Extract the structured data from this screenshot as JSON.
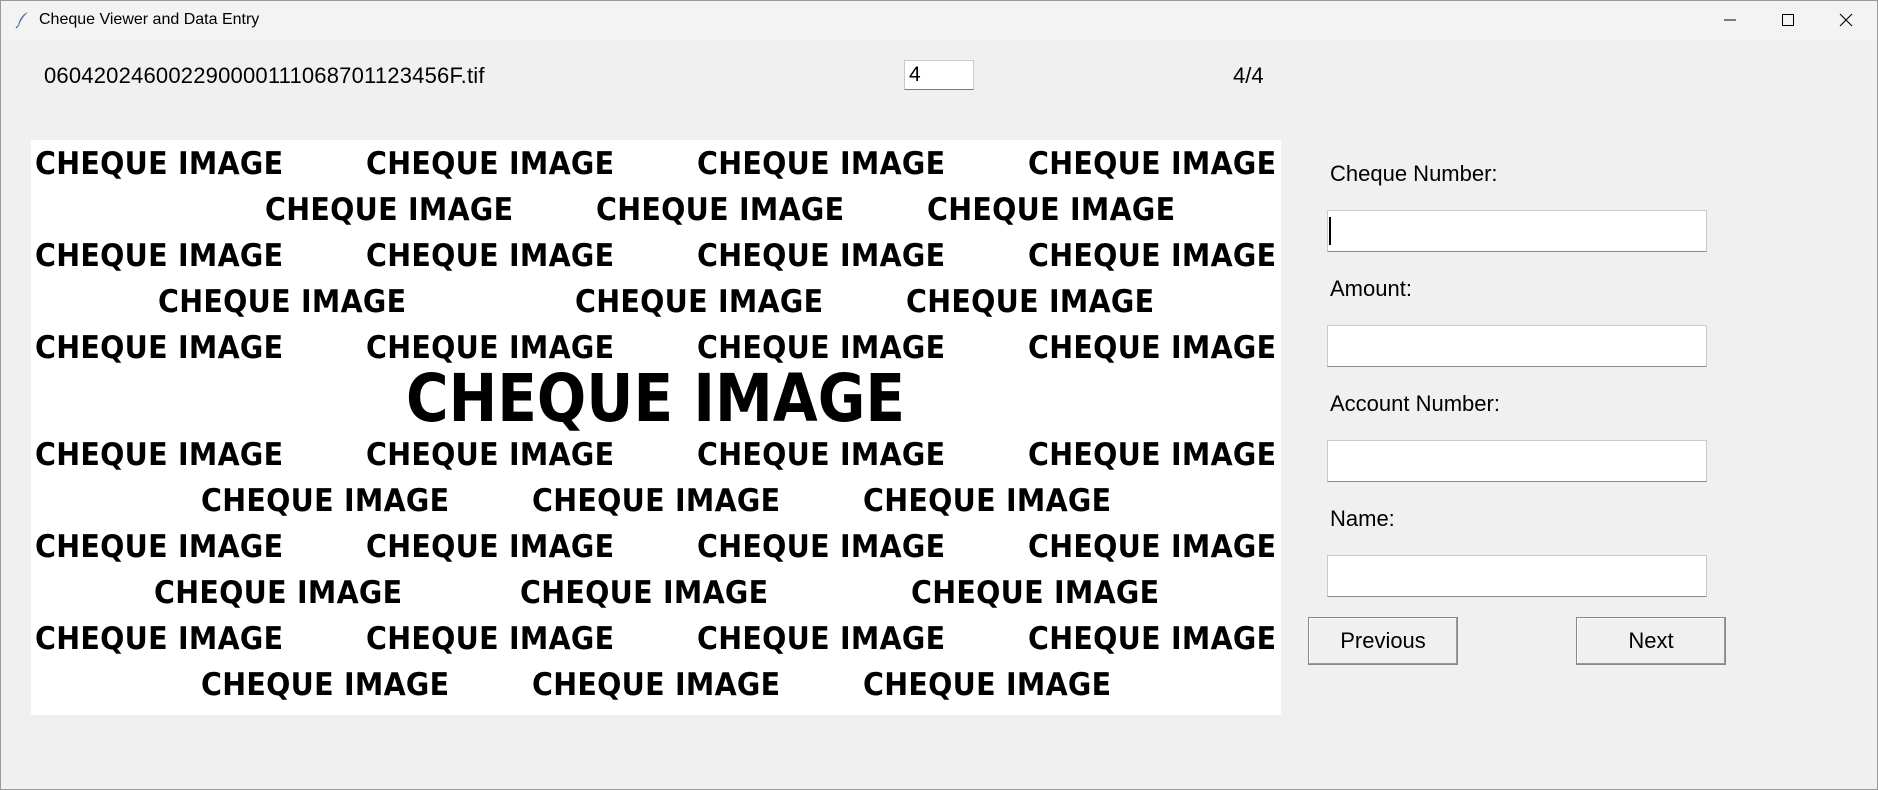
{
  "window": {
    "title": "Cheque Viewer and Data Entry",
    "icons": {
      "app": "feather-icon",
      "minimize": "minimize-icon",
      "maximize": "maximize-icon",
      "close": "close-icon"
    }
  },
  "header": {
    "filename": "060420246002290000111068701123456F.tif",
    "page_input_value": "4",
    "page_count": "4/4"
  },
  "cheque_image": {
    "watermark_text": "CHEQUE IMAGE",
    "background": "#ffffff",
    "text_color": "#000000"
  },
  "form": {
    "cheque_number_label": "Cheque Number:",
    "cheque_number_value": "",
    "amount_label": "Amount:",
    "amount_value": "",
    "account_number_label": "Account Number:",
    "account_number_value": "",
    "name_label": "Name:",
    "name_value": ""
  },
  "buttons": {
    "previous": "Previous",
    "next": "Next"
  }
}
